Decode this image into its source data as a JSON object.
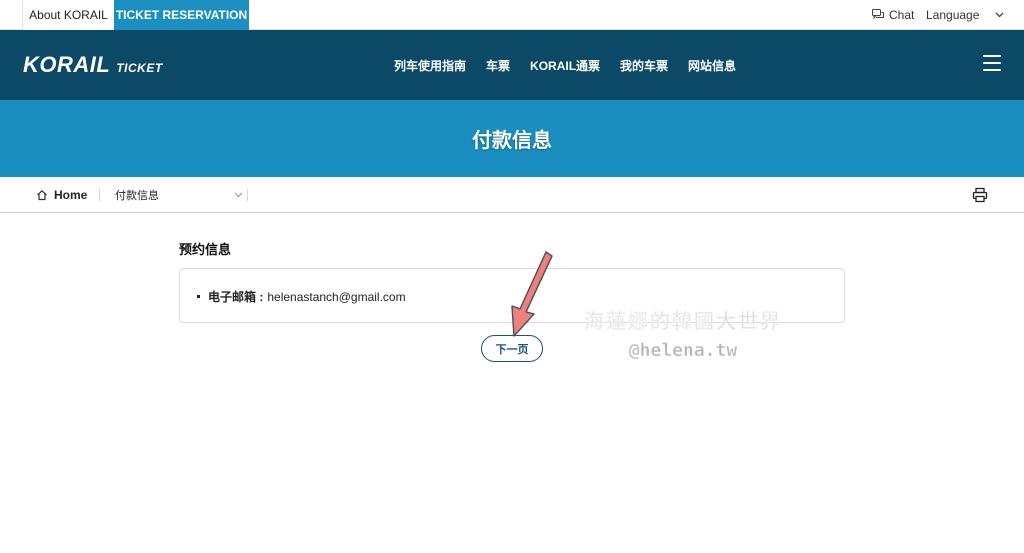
{
  "topbar": {
    "about_tab": "About KORAIL",
    "ticket_tab": "TICKET RESERVATION",
    "chat_label": "Chat",
    "chat_icon": "chat-icon",
    "language_label": "Language",
    "language_icon": "chevron-down-icon"
  },
  "header": {
    "logo_main": "KORAIL",
    "logo_sub": "TICKET",
    "nav": [
      {
        "label": "列车使用指南"
      },
      {
        "label": "车票"
      },
      {
        "label": "KORAIL通票"
      },
      {
        "label": "我的车票"
      },
      {
        "label": "网站信息"
      }
    ],
    "menu_icon": "hamburger-menu-icon"
  },
  "banner": {
    "title": "付款信息"
  },
  "breadcrumb": {
    "home_label": "Home",
    "home_icon": "home-icon",
    "current": "付款信息",
    "current_icon": "chevron-down-icon",
    "print_icon": "print-icon"
  },
  "content": {
    "section_title": "预约信息",
    "info": {
      "label": "电子邮箱 :",
      "value": "helenastanch@gmail.com"
    },
    "next_button": "下一页"
  },
  "watermark": {
    "line1": "海蓮娜的韓國大世界",
    "line2": "@helena.tw"
  },
  "colors": {
    "header_bg": "#0c4966",
    "banner_bg": "#1a8fbf",
    "ticket_tab_bg": "#1b8fc0",
    "button_border": "#1b4f8a",
    "arrow_fill": "#f08080"
  }
}
